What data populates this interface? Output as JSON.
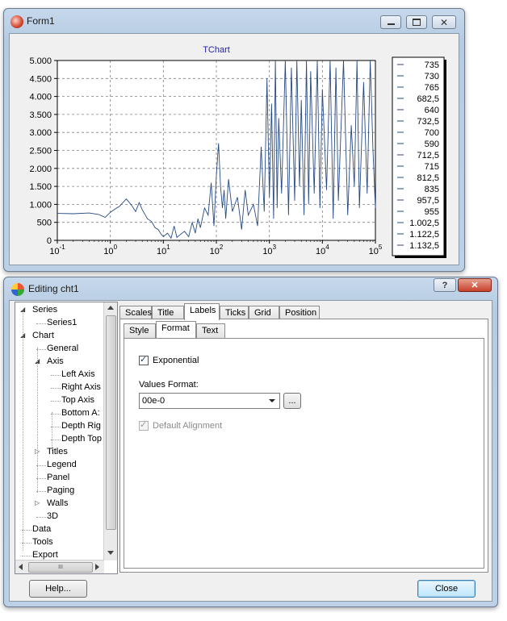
{
  "form1": {
    "title": "Form1",
    "chart_title": "TChart",
    "chart_data": {
      "type": "line",
      "title": "TChart",
      "xlabel": "",
      "ylabel": "",
      "x_scale": "log",
      "xlim": [
        0.1,
        100000
      ],
      "ylim": [
        0,
        5000
      ],
      "grid": true,
      "y_ticks": [
        "5.000",
        "4.500",
        "4.000",
        "3.500",
        "3.000",
        "2.500",
        "2.000",
        "1.500",
        "1.000",
        "500",
        "0"
      ],
      "x_ticks": [
        {
          "base": "10",
          "exp": "-1"
        },
        {
          "base": "10",
          "exp": "0"
        },
        {
          "base": "10",
          "exp": "1"
        },
        {
          "base": "10",
          "exp": "2"
        },
        {
          "base": "10",
          "exp": "3"
        },
        {
          "base": "10",
          "exp": "4"
        },
        {
          "base": "10",
          "exp": "5"
        }
      ],
      "legend_placement": "right",
      "legend": [
        "735",
        "730",
        "765",
        "682,5",
        "640",
        "732,5",
        "700",
        "590",
        "712,5",
        "715",
        "812,5",
        "835",
        "957,5",
        "955",
        "1.002,5",
        "1.122,5",
        "1.132,5"
      ],
      "series": [
        {
          "x": [
            0.1,
            0.2,
            0.4,
            0.6,
            0.8,
            1,
            1.2,
            1.5,
            2,
            2.5,
            3,
            3.5,
            4,
            5,
            6,
            7,
            8,
            9,
            10,
            12,
            14,
            16,
            18,
            20,
            25,
            30,
            35,
            40,
            45,
            50,
            60,
            70,
            80,
            90,
            100,
            110,
            120,
            130,
            140,
            150,
            170,
            200,
            250,
            300,
            350,
            400,
            500,
            600,
            700,
            800,
            900,
            1000,
            1100,
            1200,
            1300,
            1400,
            1500,
            1700,
            2000,
            2300,
            2600,
            3000,
            3300,
            3700,
            4000,
            4500,
            5000,
            5500,
            6000,
            7000,
            8000,
            9000,
            10000,
            12000,
            14000,
            16000,
            18000,
            20000,
            25000,
            30000,
            35000,
            40000,
            45000,
            50000,
            60000,
            70000,
            80000,
            90000,
            100000
          ],
          "y": [
            750,
            740,
            760,
            720,
            640,
            780,
            860,
            950,
            1150,
            980,
            800,
            1050,
            850,
            600,
            520,
            350,
            300,
            180,
            100,
            200,
            60,
            400,
            80,
            140,
            250,
            100,
            500,
            200,
            600,
            350,
            900,
            700,
            1600,
            400,
            1800,
            2700,
            1500,
            900,
            1400,
            600,
            1700,
            800,
            1200,
            300,
            1400,
            700,
            1000,
            400,
            2600,
            800,
            4500,
            1200,
            3800,
            600,
            5000,
            900,
            3400,
            1300,
            5000,
            700,
            4800,
            1100,
            5000,
            1500,
            3900,
            700,
            5000,
            1000,
            4700,
            1300,
            5000,
            900,
            4200,
            1400,
            5000,
            600,
            4800,
            1100,
            5000,
            700,
            3200,
            1500,
            5000,
            900,
            4400,
            1300,
            5000,
            2500,
            900
          ]
        }
      ]
    }
  },
  "editor": {
    "title": "Editing cht1",
    "help_button": "?",
    "tree": {
      "items": [
        {
          "label": "Series",
          "expander": "◢"
        },
        {
          "label": "Series1",
          "expander": ""
        },
        {
          "label": "Chart",
          "expander": "◢"
        },
        {
          "label": "General",
          "expander": ""
        },
        {
          "label": "Axis",
          "expander": "◢"
        },
        {
          "label": "Left Axis",
          "expander": ""
        },
        {
          "label": "Right Axis",
          "expander": ""
        },
        {
          "label": "Top Axis",
          "expander": ""
        },
        {
          "label": "Bottom A:",
          "expander": ""
        },
        {
          "label": "Depth Rig",
          "expander": ""
        },
        {
          "label": "Depth Top",
          "expander": ""
        },
        {
          "label": "Titles",
          "expander": "▷"
        },
        {
          "label": "Legend",
          "expander": ""
        },
        {
          "label": "Panel",
          "expander": ""
        },
        {
          "label": "Paging",
          "expander": ""
        },
        {
          "label": "Walls",
          "expander": "▷"
        },
        {
          "label": "3D",
          "expander": ""
        },
        {
          "label": "Data",
          "expander": ""
        },
        {
          "label": "Tools",
          "expander": ""
        },
        {
          "label": "Export",
          "expander": ""
        }
      ]
    },
    "tabs": [
      "Scales",
      "Title",
      "Labels",
      "Ticks",
      "Grid",
      "Position"
    ],
    "subtabs": [
      "Style",
      "Format",
      "Text"
    ],
    "exponential_label": "Exponential",
    "exponential_checked": true,
    "values_format_label": "Values Format:",
    "values_format_value": "00e-0",
    "ellipsis_button": "...",
    "default_alignment_label": "Default Alignment",
    "default_alignment_checked": true,
    "help_label": "Help...",
    "close_label": "Close",
    "scroll_mid": "III"
  }
}
